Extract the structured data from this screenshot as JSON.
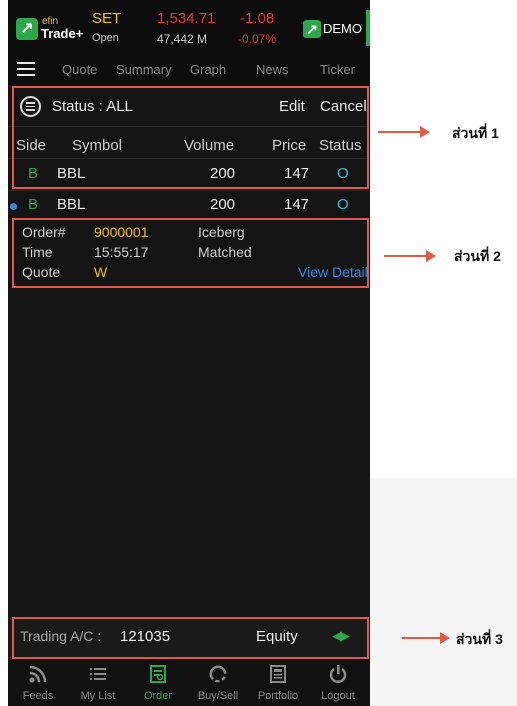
{
  "market": {
    "logo_top": "efin",
    "logo_bottom": "Trade+",
    "name": "SET",
    "state": "Open",
    "index": "1,534.71",
    "value": "47,442 M",
    "change": "-1.08",
    "change_pct": "-0.07%",
    "mode": "DEMO"
  },
  "tabs": [
    "Quote",
    "Summary",
    "Graph",
    "News",
    "Ticker"
  ],
  "order_section": {
    "status_label": "Status : ALL",
    "edit": "Edit",
    "cancel": "Cancel",
    "columns": [
      "Side",
      "Symbol",
      "Volume",
      "Price",
      "Status"
    ],
    "rows": [
      {
        "side": "B",
        "symbol": "BBL",
        "volume": "200",
        "price": "147",
        "status": "O"
      },
      {
        "side": "B",
        "symbol": "BBL",
        "volume": "200",
        "price": "147",
        "status": "O"
      }
    ]
  },
  "detail": {
    "order_label": "Order#",
    "order_value": "9000001",
    "order_type": "Iceberg",
    "time_label": "Time",
    "time_value": "15:55:17",
    "time_status": "Matched",
    "quote_label": "Quote",
    "quote_value": "W",
    "view_detail": "View Detail"
  },
  "account": {
    "label": "Trading A/C :",
    "number": "121035",
    "type": "Equity"
  },
  "bottom_nav": [
    {
      "label": "Feeds",
      "icon": "feeds-icon"
    },
    {
      "label": "My List",
      "icon": "list-icon"
    },
    {
      "label": "Order",
      "icon": "order-icon",
      "active": true
    },
    {
      "label": "Buy/Sell",
      "icon": "buysell-icon"
    },
    {
      "label": "Portfolio",
      "icon": "portfolio-icon"
    },
    {
      "label": "Logout",
      "icon": "power-icon"
    }
  ],
  "annotations": [
    "ส่วนที่ 1",
    "ส่วนที่ 2",
    "ส่วนที่ 3"
  ],
  "colors": {
    "accent_green": "#2ca84a",
    "yellow": "#f2c400",
    "red": "#e2353a",
    "cyan": "#26c6da",
    "callout": "#e05a4a"
  }
}
